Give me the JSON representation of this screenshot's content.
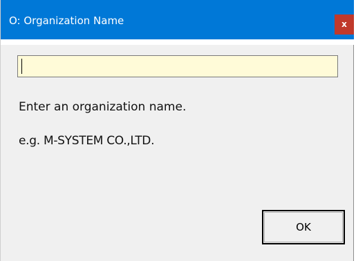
{
  "window": {
    "title": "O: Organization Name",
    "close_label": "x"
  },
  "input": {
    "value": "",
    "placeholder": ""
  },
  "instruction": "Enter an organization name.",
  "example": "e.g. M-SYSTEM CO.,LTD.",
  "ok_label": "OK",
  "colors": {
    "titlebar": "#0078d7",
    "close_button": "#c0392b",
    "input_background": "#fffbd8",
    "dialog_background": "#f0f0f0"
  }
}
